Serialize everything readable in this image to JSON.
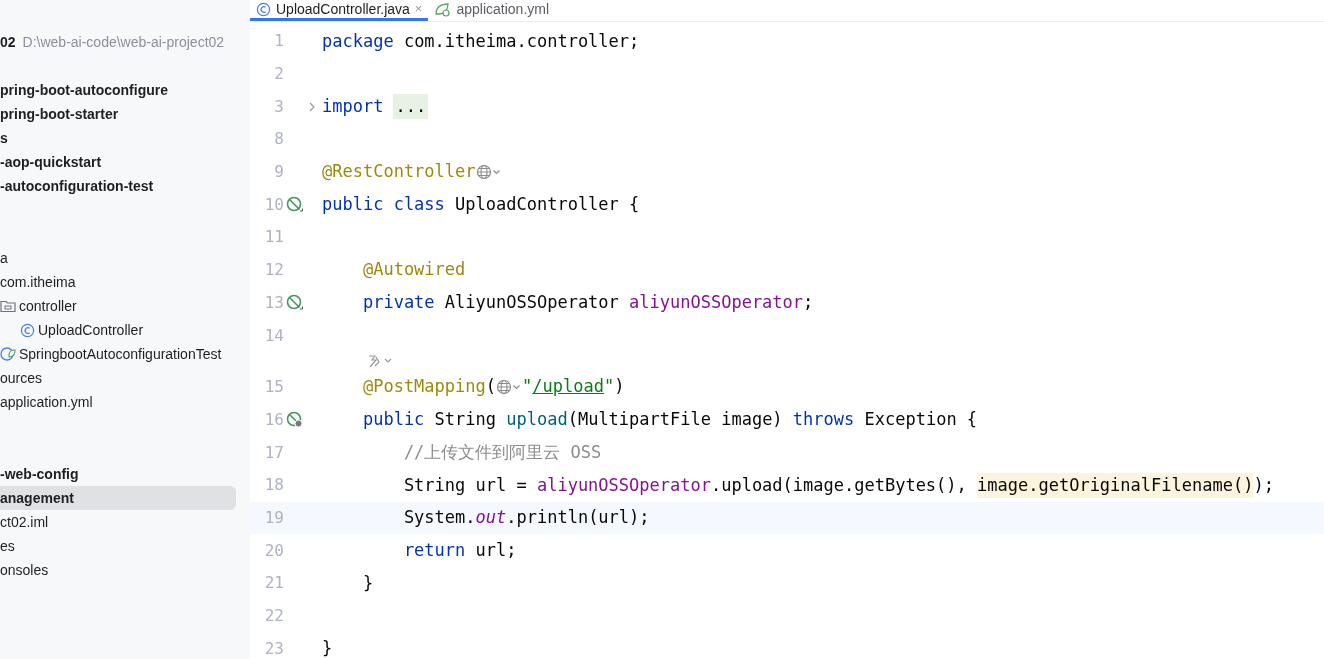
{
  "tabs": [
    {
      "kind": "class",
      "label": "UploadController.java",
      "selected": true,
      "close": "×"
    },
    {
      "kind": "yaml",
      "label": "application.yml",
      "selected": false
    }
  ],
  "project_tree": {
    "items": [
      {
        "kind": "node",
        "label": "02",
        "bold": true,
        "note": "D:\\web-ai-code\\web-ai-project02",
        "selected": false
      },
      {
        "kind": "blank"
      },
      {
        "kind": "node",
        "label": "pring-boot-autoconfigure",
        "bold": true,
        "selected": false
      },
      {
        "kind": "node",
        "label": "pring-boot-starter",
        "bold": true,
        "selected": false
      },
      {
        "kind": "node",
        "label": "s",
        "bold": true,
        "selected": false
      },
      {
        "kind": "node",
        "label": "-aop-quickstart",
        "bold": true,
        "selected": false
      },
      {
        "kind": "node",
        "label": "-autoconfiguration-test",
        "bold": true,
        "selected": false
      },
      {
        "kind": "blank"
      },
      {
        "kind": "blank"
      },
      {
        "kind": "node",
        "label": "a",
        "bold": false,
        "selected": false
      },
      {
        "kind": "node",
        "label": "com.itheima",
        "bold": false,
        "selected": false
      },
      {
        "kind": "folder",
        "label": "controller",
        "bold": false,
        "selected": false,
        "children": [
          {
            "kind": "class",
            "label": "UploadController",
            "bold": false,
            "selected": false
          }
        ]
      },
      {
        "kind": "spring",
        "label": "SpringbootAutoconfigurationTest",
        "bold": false,
        "selected": false
      },
      {
        "kind": "node",
        "label": "ources",
        "bold": false,
        "selected": false
      },
      {
        "kind": "node",
        "label": "application.yml",
        "bold": false,
        "selected": false
      },
      {
        "kind": "blank"
      },
      {
        "kind": "blank"
      },
      {
        "kind": "node",
        "label": "-web-config",
        "bold": true,
        "selected": false
      },
      {
        "kind": "node",
        "label": "anagement",
        "bold": true,
        "selected": true
      },
      {
        "kind": "node",
        "label": "ct02.iml",
        "bold": false,
        "selected": false
      },
      {
        "kind": "node",
        "label": "es",
        "bold": false,
        "selected": false
      },
      {
        "kind": "node",
        "label": "onsoles",
        "bold": false,
        "selected": false
      }
    ]
  },
  "editor": {
    "lines": [
      {
        "kind": "code",
        "number": "1",
        "tokens": [
          {
            "kind": "kw",
            "t": "package"
          },
          {
            "kind": "plain",
            "t": " com.itheima.controller;"
          }
        ]
      },
      {
        "kind": "code",
        "number": "2"
      },
      {
        "kind": "code",
        "number": "3",
        "foldable": true,
        "tokens": [
          {
            "kind": "kw",
            "t": "import"
          },
          {
            "kind": "folded",
            "t": "..."
          }
        ]
      },
      {
        "kind": "code",
        "number": "8"
      },
      {
        "kind": "code",
        "number": "9",
        "tokens": [
          {
            "kind": "ann",
            "t": "@RestController"
          },
          {
            "kind": "globe"
          }
        ]
      },
      {
        "kind": "bean",
        "number": "10",
        "tokens": [
          {
            "kind": "kw",
            "t": "public class"
          },
          {
            "kind": "plain",
            "t": " UploadController {"
          }
        ]
      },
      {
        "kind": "code",
        "number": "11"
      },
      {
        "kind": "code",
        "number": "12",
        "tokens": [
          {
            "kind": "ann",
            "t": "    @Autowired"
          }
        ]
      },
      {
        "kind": "bean",
        "number": "13",
        "tokens": [
          {
            "kind": "kw",
            "t": "    private"
          },
          {
            "kind": "plain",
            "t": " AliyunOSSOperator "
          },
          {
            "kind": "field",
            "t": "aliyunOSSOperator"
          },
          {
            "kind": "plain",
            "t": ";"
          }
        ]
      },
      {
        "kind": "code",
        "number": "14"
      },
      {
        "kind": "code",
        "number": "15",
        "inlay": true,
        "tokens": [
          {
            "kind": "ann",
            "t": "    @PostMapping"
          },
          {
            "kind": "plain",
            "t": "("
          },
          {
            "kind": "globe"
          },
          {
            "kind": "str",
            "t": "\""
          },
          {
            "kind": "link",
            "t": "/upload"
          },
          {
            "kind": "str",
            "t": "\""
          },
          {
            "kind": "plain",
            "t": ")"
          }
        ]
      },
      {
        "kind": "endpoint",
        "number": "16",
        "tokens": [
          {
            "kind": "kw",
            "t": "    public"
          },
          {
            "kind": "plain",
            "t": " String "
          },
          {
            "kind": "method",
            "t": "upload"
          },
          {
            "kind": "plain",
            "t": "(MultipartFile image) "
          },
          {
            "kind": "kw",
            "t": "throws"
          },
          {
            "kind": "plain",
            "t": " Exception {"
          }
        ]
      },
      {
        "kind": "code",
        "number": "17",
        "tokens": [
          {
            "kind": "comment",
            "t": "        //上传文件到阿里云 OSS"
          }
        ]
      },
      {
        "kind": "code",
        "number": "18",
        "tokens": [
          {
            "kind": "plain",
            "t": "        String url = "
          },
          {
            "kind": "field",
            "t": "aliyunOSSOperator"
          },
          {
            "kind": "plain",
            "t": ".upload(image.getBytes(), "
          },
          {
            "kind": "hl",
            "t": "image.getOriginalFilename()"
          },
          {
            "kind": "plain",
            "t": ");"
          }
        ]
      },
      {
        "kind": "code",
        "number": "19",
        "current": true,
        "tokens": [
          {
            "kind": "plain",
            "t": "        System."
          },
          {
            "kind": "static",
            "t": "out"
          },
          {
            "kind": "plain",
            "t": ".println(url);"
          }
        ]
      },
      {
        "kind": "code",
        "number": "20",
        "tokens": [
          {
            "kind": "kw",
            "t": "        return"
          },
          {
            "kind": "plain",
            "t": " url;"
          }
        ]
      },
      {
        "kind": "code",
        "number": "21",
        "tokens": [
          {
            "kind": "plain",
            "t": "    }"
          }
        ]
      },
      {
        "kind": "code",
        "number": "22"
      },
      {
        "kind": "code",
        "number": "23",
        "tokens": [
          {
            "kind": "plain",
            "t": "}"
          }
        ]
      }
    ]
  }
}
